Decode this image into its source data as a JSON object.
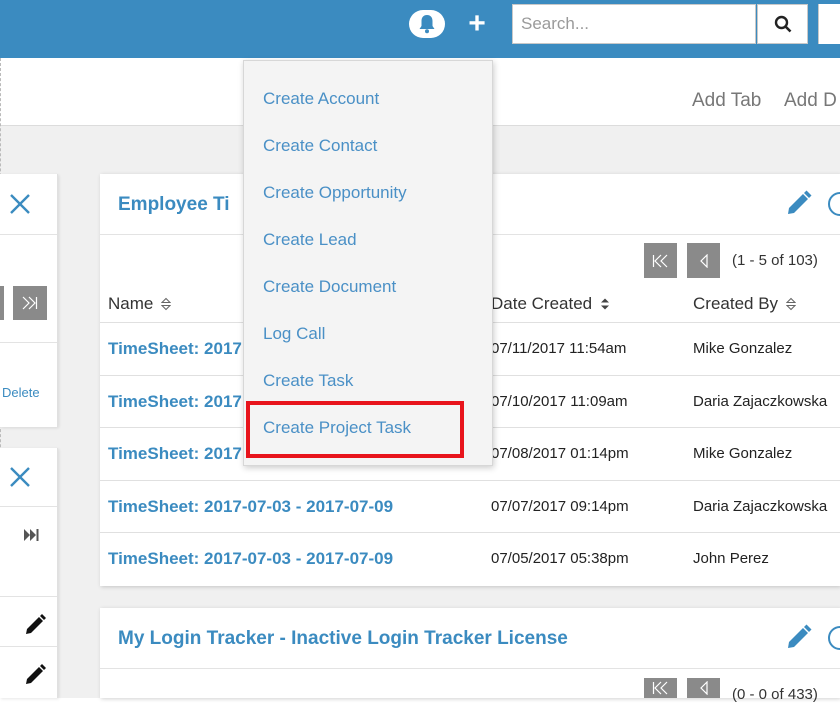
{
  "header": {
    "search_placeholder": "Search...",
    "add_tab": "Add Tab",
    "add_dashlet": "Add D"
  },
  "create_menu": {
    "items": [
      "Create Account",
      "Create Contact",
      "Create Opportunity",
      "Create Lead",
      "Create Document",
      "Log Call",
      "Create Task",
      "Create Project Task"
    ]
  },
  "left_panel": {
    "delete_label": "Delete"
  },
  "dashlet1": {
    "title": "Employee Ti",
    "pager": "(1 - 5 of 103)",
    "columns": [
      "Name",
      "Date Created",
      "Created By"
    ],
    "rows": [
      {
        "name": "TimeSheet: 2017",
        "date": "07/11/2017 11:54am",
        "by": "Mike Gonzalez"
      },
      {
        "name": "TimeSheet: 2017",
        "date": "07/10/2017 11:09am",
        "by": "Daria Zajaczkowska"
      },
      {
        "name": "TimeSheet: 2017",
        "date": "07/08/2017 01:14pm",
        "by": "Mike Gonzalez"
      },
      {
        "name": "TimeSheet: 2017-07-03 - 2017-07-09",
        "date": "07/07/2017 09:14pm",
        "by": "Daria Zajaczkowska"
      },
      {
        "name": "TimeSheet: 2017-07-03 - 2017-07-09",
        "date": "07/05/2017 05:38pm",
        "by": "John Perez"
      }
    ]
  },
  "dashlet2": {
    "title": "My Login Tracker - Inactive Login Tracker License",
    "pager": "(0 - 0 of 433)"
  },
  "colors": {
    "header_bg": "#3b8bc0",
    "link": "#3b8bc0",
    "highlight": "#e8141c"
  }
}
